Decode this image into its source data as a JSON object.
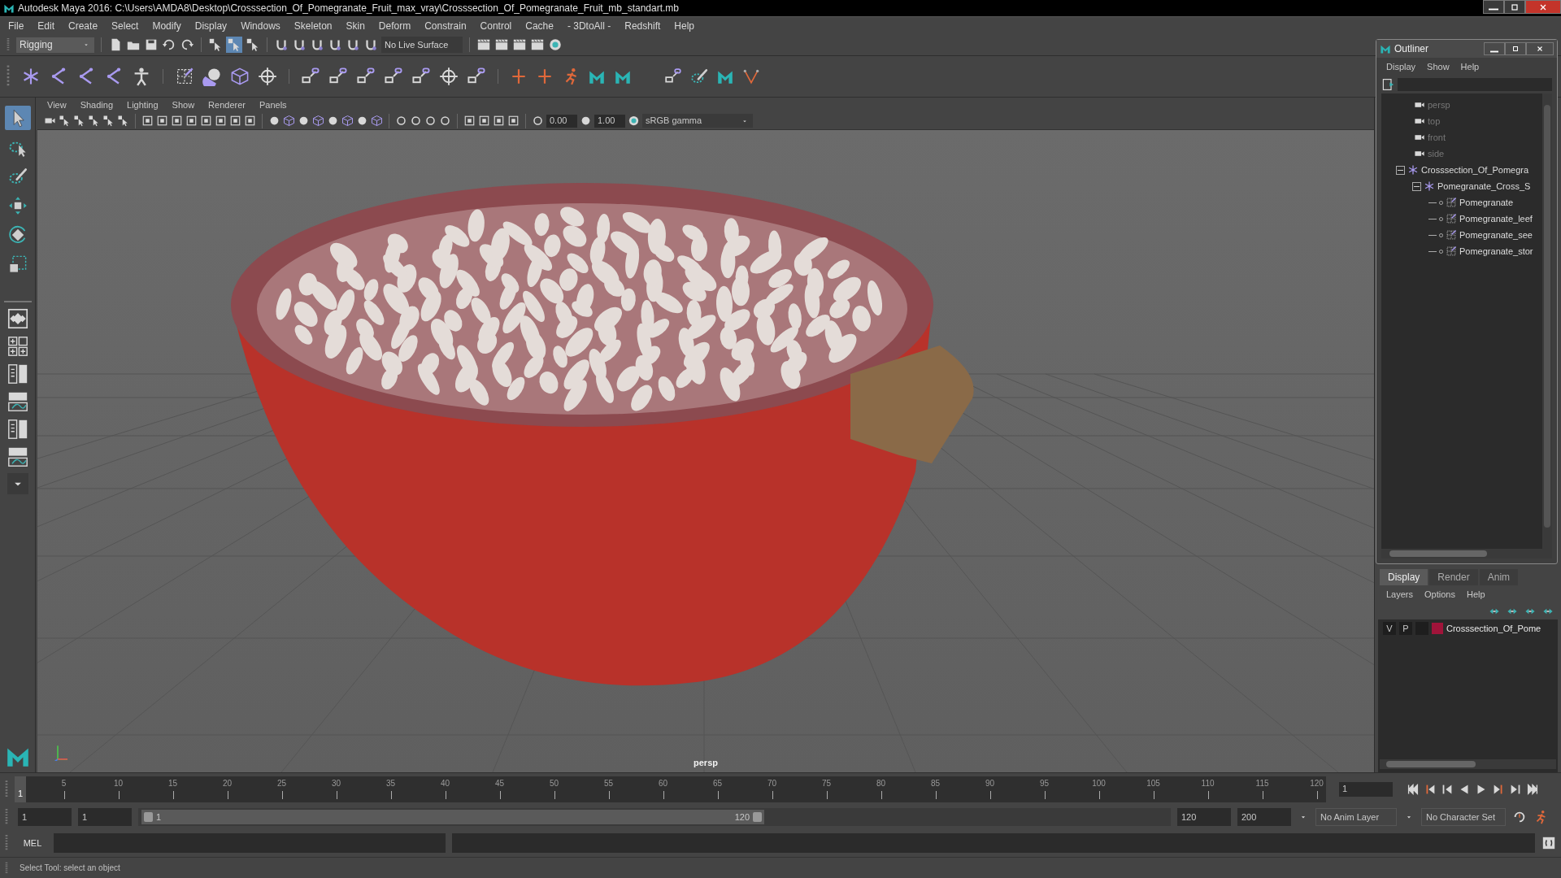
{
  "window": {
    "title": "Autodesk Maya 2016: C:\\Users\\AMDA8\\Desktop\\Crosssection_Of_Pomegranate_Fruit_max_vray\\Crosssection_Of_Pomegranate_Fruit_mb_standart.mb"
  },
  "menu_bar": [
    "File",
    "Edit",
    "Create",
    "Select",
    "Modify",
    "Display",
    "Windows",
    "Skeleton",
    "Skin",
    "Deform",
    "Constrain",
    "Control",
    "Cache",
    "- 3DtoAll -",
    "Redshift",
    "Help"
  ],
  "status_line": {
    "menu_set": "Rigging",
    "live_surface": "No Live Surface"
  },
  "toolbox": {
    "tools": [
      {
        "kind": "select",
        "selected": true
      },
      {
        "kind": "lasso",
        "selected": false
      },
      {
        "kind": "paint",
        "selected": false
      },
      {
        "kind": "move",
        "selected": false
      },
      {
        "kind": "rotate",
        "selected": false
      },
      {
        "kind": "scale",
        "selected": false
      }
    ]
  },
  "viewport": {
    "menus": [
      "View",
      "Shading",
      "Lighting",
      "Show",
      "Renderer",
      "Panels"
    ],
    "exposure": "0.00",
    "gamma": "1.00",
    "color_space": "sRGB gamma",
    "camera_label": "persp"
  },
  "outliner": {
    "title": "Outliner",
    "menus": [
      "Display",
      "Show",
      "Help"
    ],
    "items": [
      {
        "label": "persp",
        "kind": "camera"
      },
      {
        "label": "top",
        "kind": "camera"
      },
      {
        "label": "front",
        "kind": "camera"
      },
      {
        "label": "side",
        "kind": "camera"
      },
      {
        "label": "Crosssection_Of_Pomegra",
        "kind": "group",
        "expanded": true,
        "children": [
          {
            "label": "Pomegranate_Cross_S",
            "kind": "group",
            "expanded": true,
            "children": [
              {
                "label": "Pomegranate",
                "kind": "mesh"
              },
              {
                "label": "Pomegranate_leef",
                "kind": "mesh"
              },
              {
                "label": "Pomegranate_see",
                "kind": "mesh"
              },
              {
                "label": "Pomegranate_stor",
                "kind": "mesh"
              }
            ]
          }
        ]
      }
    ]
  },
  "layer_editor": {
    "tabs": [
      {
        "label": "Display",
        "selected": true
      },
      {
        "label": "Render",
        "selected": false
      },
      {
        "label": "Anim",
        "selected": false
      }
    ],
    "menus": [
      "Layers",
      "Options",
      "Help"
    ],
    "layers": [
      {
        "visibility": "V",
        "playback": "P",
        "name": "Crosssection_Of_Pome",
        "color": "#a0143a"
      }
    ]
  },
  "time_slider": {
    "labels": [
      "5",
      "10",
      "15",
      "20",
      "25",
      "30",
      "35",
      "40",
      "45",
      "50",
      "55",
      "60",
      "65",
      "70",
      "75",
      "80",
      "85",
      "90",
      "95",
      "100",
      "105",
      "110",
      "115",
      "120"
    ],
    "current_frame": "1",
    "level": 0,
    "frame_field": "1"
  },
  "range_slider": {
    "start": "1",
    "playback_start": "1",
    "range_start": "1",
    "range_end": "120",
    "playback_end": "120",
    "end": "200",
    "anim_layer": "No Anim Layer",
    "character_set": "No Character Set"
  },
  "command_line": {
    "language": "MEL"
  },
  "help_line": "Select Tool: select an object"
}
